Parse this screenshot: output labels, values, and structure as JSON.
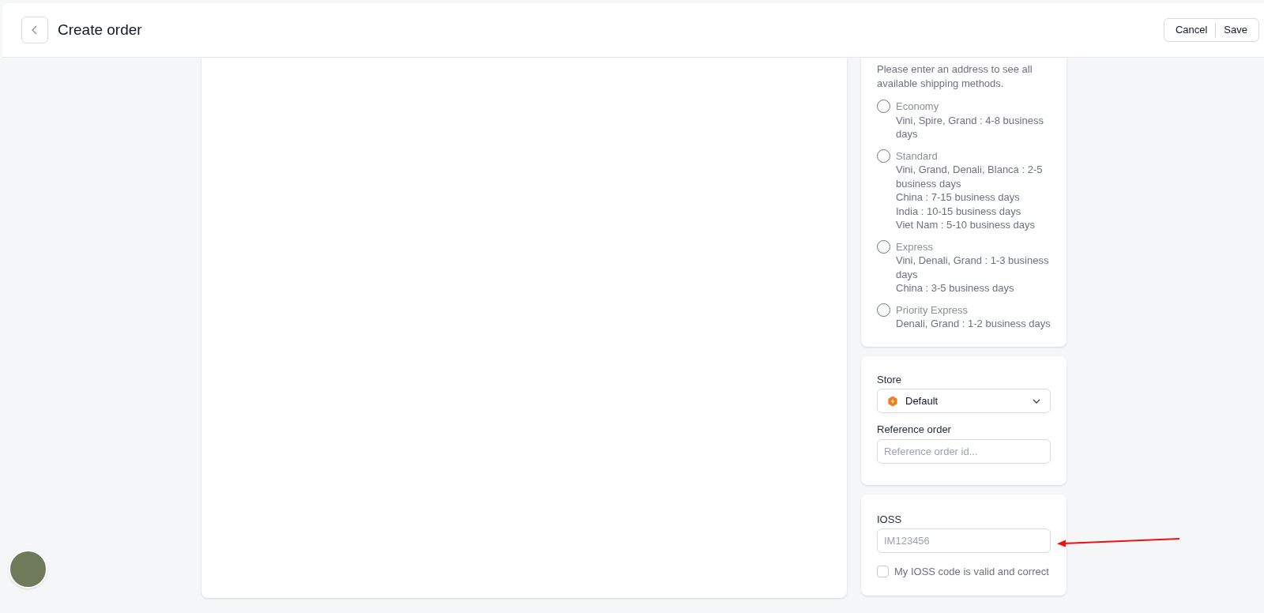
{
  "header": {
    "title": "Create order",
    "buttons": [
      "Cancel",
      "Save"
    ]
  },
  "shipping": {
    "note": "Please enter an address to see all available shipping methods.",
    "methods": [
      {
        "name": "Economy",
        "selected": false,
        "lines": [
          "Vini, Spire, Grand : 4-8 business days"
        ]
      },
      {
        "name": "Standard",
        "selected": false,
        "lines": [
          "Vini, Grand, Denali, Blanca : 2-5 business days",
          "China : 7-15 business days",
          "India : 10-15 business days",
          "Viet Nam : 5-10 business days"
        ]
      },
      {
        "name": "Express",
        "selected": false,
        "lines": [
          "Vini, Denali, Grand : 1-3 business days",
          "China : 3-5 business days"
        ]
      },
      {
        "name": "Priority Express",
        "selected": false,
        "lines": [
          "Denali, Grand : 1-2 business days"
        ]
      }
    ]
  },
  "store": {
    "label": "Store",
    "value": "Default"
  },
  "reference_order": {
    "label": "Reference order",
    "placeholder": "Reference order id..."
  },
  "ioss": {
    "label": "IOSS",
    "placeholder": "IM123456",
    "confirm": {
      "label": "My IOSS code is valid and correct",
      "checked": false
    }
  }
}
